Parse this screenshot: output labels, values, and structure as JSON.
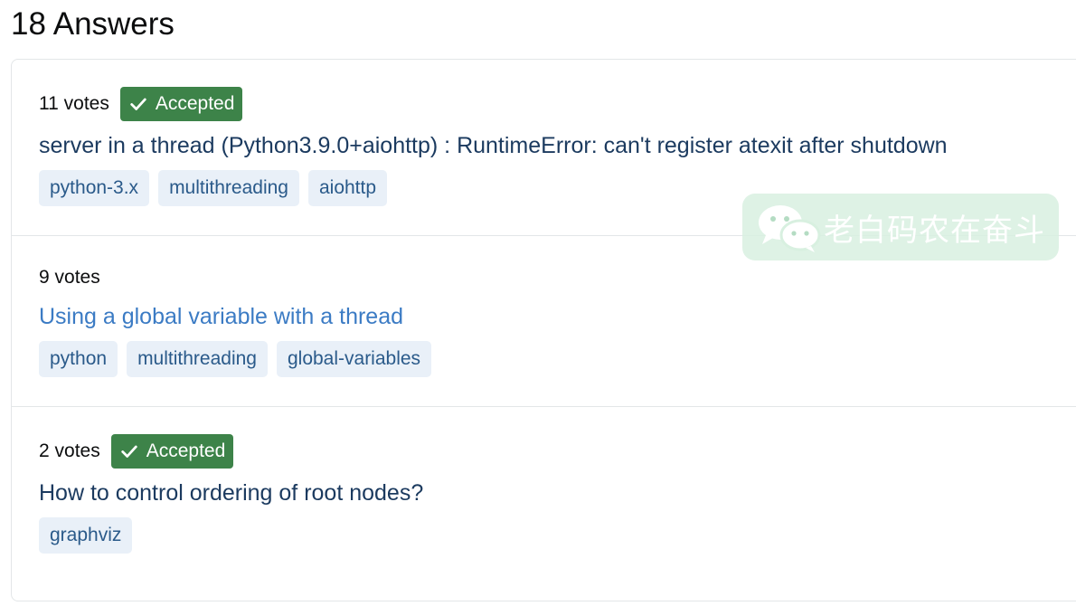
{
  "heading": "18 Answers",
  "answers": [
    {
      "votes": "11 votes",
      "accepted_label": "Accepted",
      "title": "server in a thread (Python3.9.0+aiohttp) : RuntimeError: can't register atexit after shutdown",
      "tags": [
        "python-3.x",
        "multithreading",
        "aiohttp"
      ]
    },
    {
      "votes": "9 votes",
      "title": "Using a global variable with a thread",
      "tags": [
        "python",
        "multithreading",
        "global-variables"
      ]
    },
    {
      "votes": "2 votes",
      "accepted_label": "Accepted",
      "title": "How to control ordering of root nodes?",
      "tags": [
        "graphviz"
      ]
    }
  ],
  "watermark": {
    "text": "老白码农在奋斗",
    "icon": "wechat-icon"
  },
  "colors": {
    "accepted_bg": "#3d8349",
    "tag_bg": "#e9f0f8",
    "tag_text": "#2a5a8a",
    "title_text": "#1b3a5f",
    "visited_title_text": "#3b7bc4",
    "border": "#e3e6e8"
  }
}
